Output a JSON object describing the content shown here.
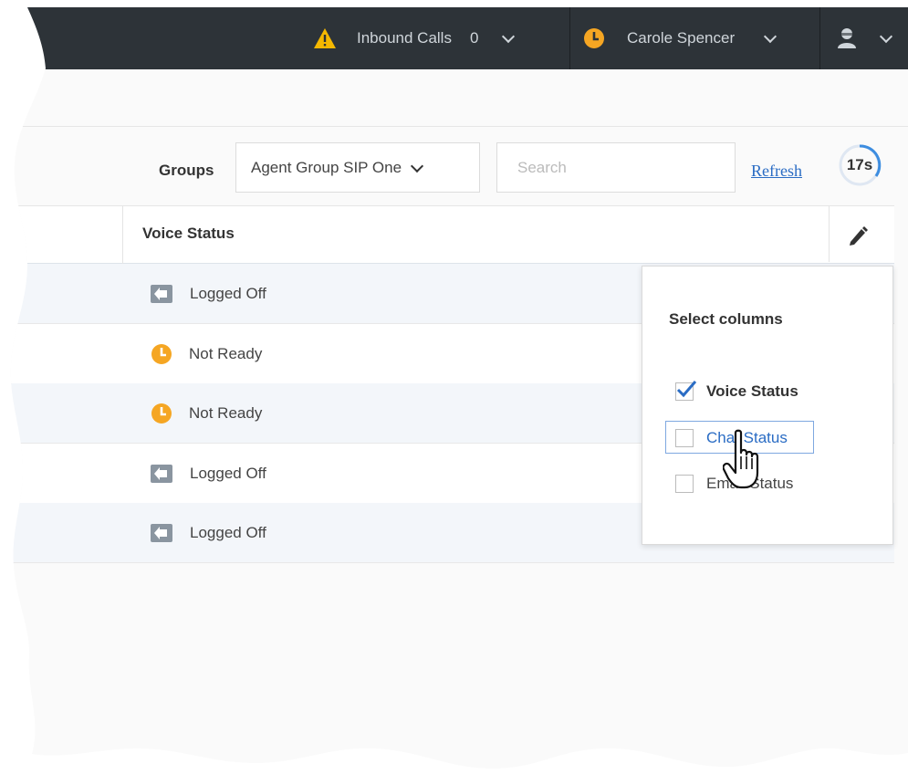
{
  "topbar": {
    "inbound_label": "Inbound Calls",
    "inbound_count": "0",
    "agent_name": "Carole Spencer",
    "warning_color": "#f5b800",
    "status_color": "#f5a623"
  },
  "toolbar": {
    "groups_label": "Groups",
    "groups_selected": "Agent Group SIP One",
    "search_placeholder": "Search",
    "refresh_label": "Refresh",
    "timer": "17s"
  },
  "table": {
    "column_header": "Voice Status",
    "rows": [
      {
        "status": "Logged Off",
        "icon": "logged-off-icon"
      },
      {
        "status": "Not Ready",
        "icon": "not-ready-icon"
      },
      {
        "status": "Not Ready",
        "icon": "not-ready-icon"
      },
      {
        "status": "Logged Off",
        "icon": "logged-off-icon"
      },
      {
        "status": "Logged Off",
        "icon": "logged-off-icon"
      }
    ]
  },
  "column_selector": {
    "title": "Select columns",
    "options": [
      {
        "label": "Voice Status",
        "checked": true
      },
      {
        "label": "Chat Status",
        "checked": false
      },
      {
        "label": "Email Status",
        "checked": false
      }
    ]
  }
}
